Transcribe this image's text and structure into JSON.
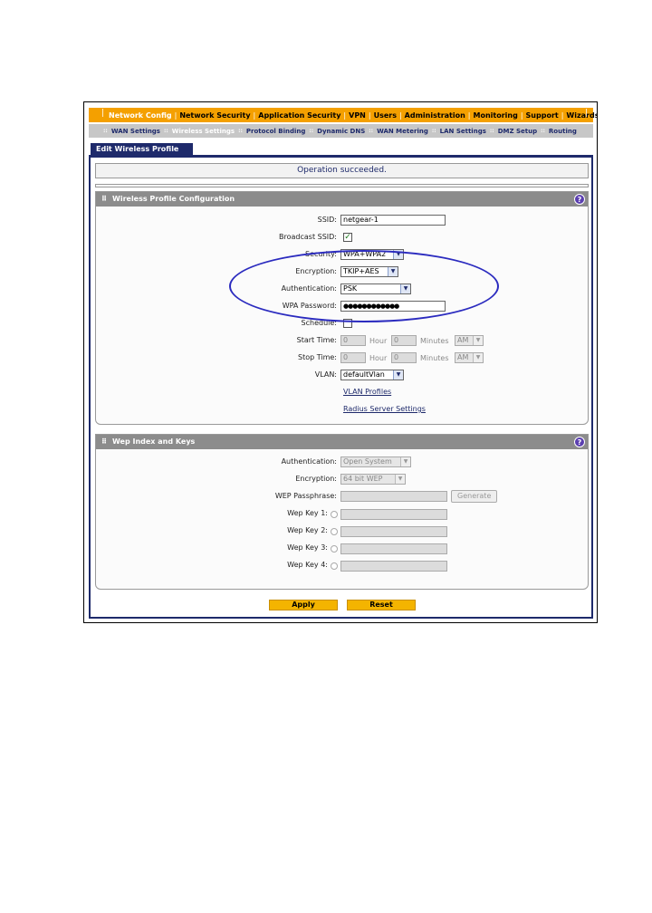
{
  "main_nav": {
    "items": [
      "Network Config",
      "Network Security",
      "Application Security",
      "VPN",
      "Users",
      "Administration",
      "Monitoring",
      "Support",
      "Wizards"
    ],
    "active": "Network Config"
  },
  "sub_nav": {
    "items": [
      "WAN Settings",
      "Wireless Settings",
      "Protocol Binding",
      "Dynamic DNS",
      "WAN Metering",
      "LAN Settings",
      "DMZ Setup",
      "Routing"
    ],
    "active": "Wireless Settings"
  },
  "tab": {
    "label": "Edit Wireless Profile"
  },
  "status_message": "Operation succeeded.",
  "wireless_profile": {
    "title": "Wireless Profile Configuration",
    "ssid_label": "SSID:",
    "ssid_value": "netgear-1",
    "broadcast_label": "Broadcast SSID:",
    "broadcast_checked": true,
    "security_label": "Security:",
    "security_value": "WPA+WPA2",
    "encryption_label": "Encryption:",
    "encryption_value": "TKIP+AES",
    "authentication_label": "Authentication:",
    "authentication_value": "PSK",
    "wpa_password_label": "WPA Password:",
    "wpa_password_value": "●●●●●●●●●●●●",
    "schedule_label": "Schedule:",
    "start_time_label": "Start Time:",
    "start_hour": "0",
    "start_minutes": "0",
    "start_ampm": "AM",
    "stop_time_label": "Stop Time:",
    "stop_hour": "0",
    "stop_minutes": "0",
    "stop_ampm": "AM",
    "hour_label": "Hour",
    "minutes_label": "Minutes",
    "vlan_label": "VLAN:",
    "vlan_value": "defaultVlan",
    "vlan_profiles_link": "VLAN Profiles",
    "radius_link": "Radius Server Settings"
  },
  "wep": {
    "title": "Wep Index and Keys",
    "authentication_label": "Authentication:",
    "authentication_value": "Open System",
    "encryption_label": "Encryption:",
    "encryption_value": "64 bit WEP",
    "passphrase_label": "WEP Passphrase:",
    "generate_label": "Generate",
    "key1_label": "Wep Key 1:",
    "key2_label": "Wep Key 2:",
    "key3_label": "Wep Key 3:",
    "key4_label": "Wep Key 4:"
  },
  "buttons": {
    "apply": "Apply",
    "reset": "Reset"
  },
  "colors": {
    "nav_orange": "#f4a000",
    "navy": "#1e2a6b",
    "annotation_blue": "#2b2bbf",
    "button_yellow": "#f4b400"
  }
}
